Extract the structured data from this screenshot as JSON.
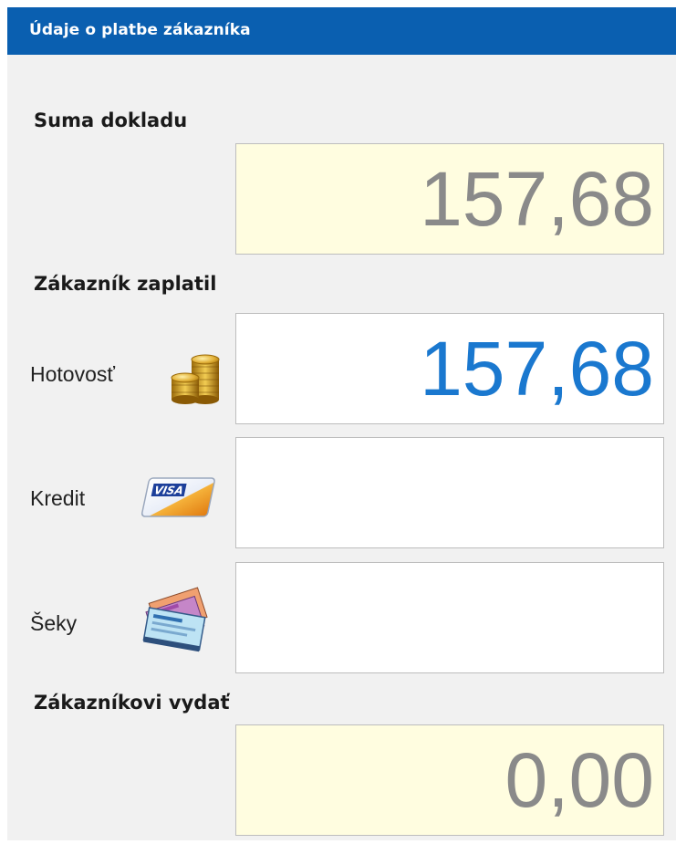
{
  "panel": {
    "title": "Údaje o platbe zákazníka"
  },
  "receipt_total": {
    "label": "Suma dokladu",
    "value": "157,68"
  },
  "customer_paid": {
    "label": "Zákazník zaplatil",
    "methods": [
      {
        "label": "Hotovosť",
        "icon": "coins-icon",
        "value": "157,68"
      },
      {
        "label": "Kredit",
        "icon": "credit-card-icon",
        "value": ""
      },
      {
        "label": "Šeky",
        "icon": "checks-icon",
        "value": ""
      }
    ]
  },
  "change_due": {
    "label": "Zákazníkovi vydať",
    "value": "0,00"
  },
  "colors": {
    "header": "#0a5fb0",
    "panel_background": "#f1f1f1",
    "readonly_field": "#fffde0",
    "entered_amount": "#1a78cf",
    "readonly_amount": "#8a8a8a"
  }
}
